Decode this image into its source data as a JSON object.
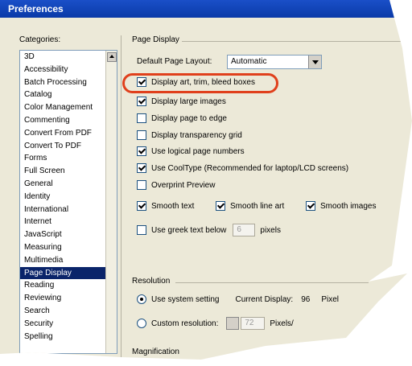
{
  "window": {
    "title": "Preferences"
  },
  "categories": {
    "label": "Categories:",
    "items": [
      "3D",
      "Accessibility",
      "Batch Processing",
      "Catalog",
      "Color Management",
      "Commenting",
      "Convert From PDF",
      "Convert To PDF",
      "Forms",
      "Full Screen",
      "General",
      "Identity",
      "International",
      "Internet",
      "JavaScript",
      "Measuring",
      "Multimedia",
      "Page Display",
      "Reading",
      "Reviewing",
      "Search",
      "Security",
      "Spelling"
    ],
    "selected": "Page Display"
  },
  "page_display": {
    "group_label": "Page Display",
    "layout_label": "Default Page Layout:",
    "layout_value": "Automatic",
    "options": [
      {
        "label": "Display art, trim, bleed boxes",
        "checked": true
      },
      {
        "label": "Display large images",
        "checked": true
      },
      {
        "label": "Display page to edge",
        "checked": false
      },
      {
        "label": "Display transparency grid",
        "checked": false
      },
      {
        "label": "Use logical page numbers",
        "checked": true
      },
      {
        "label": "Use CoolType (Recommended for laptop/LCD screens)",
        "checked": true
      },
      {
        "label": "Overprint Preview",
        "checked": false
      }
    ],
    "smooth": [
      {
        "label": "Smooth text",
        "checked": true
      },
      {
        "label": "Smooth line art",
        "checked": true
      },
      {
        "label": "Smooth images",
        "checked": true
      }
    ],
    "greek": {
      "label": "Use greek text below",
      "value": "6",
      "unit": "pixels",
      "checked": false
    }
  },
  "resolution": {
    "group_label": "Resolution",
    "system_label": "Use system setting",
    "current_label": "Current Display:",
    "current_value": "96",
    "current_unit": "Pixel",
    "custom_label": "Custom resolution:",
    "custom_value": "72",
    "custom_unit": "Pixels/"
  },
  "magnification": {
    "group_label": "Magnification"
  }
}
